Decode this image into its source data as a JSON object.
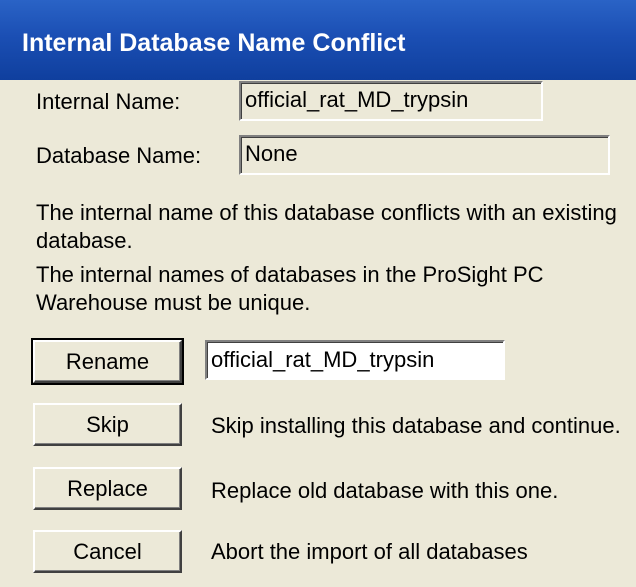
{
  "window": {
    "title": "Internal Database Name Conflict"
  },
  "fields": {
    "internal_name_label": "Internal Name:",
    "internal_name_value": "official_rat_MD_trypsin",
    "database_name_label": "Database Name:",
    "database_name_value": "None"
  },
  "messages": {
    "conflict": "The internal name of this database conflicts with an existing database.",
    "unique": "The internal names of databases in the ProSight PC Warehouse must be unique."
  },
  "actions": {
    "rename_label": "Rename",
    "rename_value": "official_rat_MD_trypsin",
    "skip_label": "Skip",
    "skip_desc": "Skip installing this database and continue.",
    "replace_label": "Replace",
    "replace_desc": "Replace old database with this one.",
    "cancel_label": "Cancel",
    "cancel_desc": "Abort the import of all databases"
  },
  "colors": {
    "titlebar": "#1b4fb4",
    "dialog_background": "#ece9d8",
    "title_text": "#ffffff"
  }
}
